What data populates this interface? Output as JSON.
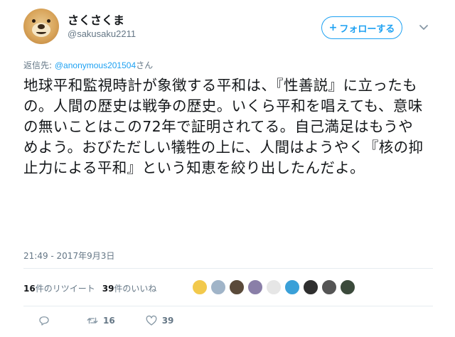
{
  "user": {
    "display_name": "さくさくま",
    "handle": "@sakusaku2211"
  },
  "follow_button": {
    "label": "フォローする",
    "plus": "+"
  },
  "reply_to": {
    "prefix": "返信先: ",
    "mention": "@anonymous201504",
    "suffix": "さん"
  },
  "tweet": {
    "text": "地球平和監視時計が象徴する平和は、『性善説』に立ったもの。人間の歴史は戦争の歴史。いくら平和を唱えても、意味の無いことはこの72年で証明されてる。自己満足はもうやめよう。おびただしい犠牲の上に、人間はようやく『核の抑止力による平和』という知恵を絞り出したんだよ。",
    "timestamp": "21:49 - 2017年9月3日"
  },
  "stats": {
    "retweets_count": "16",
    "retweets_label": "件のリツイート",
    "likes_count": "39",
    "likes_label": "件のいいね"
  },
  "likers": [
    {
      "icon": "liker-avatar-1",
      "color": "#f2c94c"
    },
    {
      "icon": "liker-avatar-2",
      "color": "#a0b4c8"
    },
    {
      "icon": "liker-avatar-3",
      "color": "#5a4a3a"
    },
    {
      "icon": "liker-avatar-4",
      "color": "#8a7fa8"
    },
    {
      "icon": "liker-avatar-5",
      "color": "#e6e6e6"
    },
    {
      "icon": "liker-avatar-6",
      "color": "#3aa0d8"
    },
    {
      "icon": "liker-avatar-7",
      "color": "#2e2e2e"
    },
    {
      "icon": "liker-avatar-8",
      "color": "#555555"
    },
    {
      "icon": "liker-avatar-9",
      "color": "#3b4a3b"
    }
  ],
  "actions": {
    "retweet_count": "16",
    "like_count": "39"
  }
}
